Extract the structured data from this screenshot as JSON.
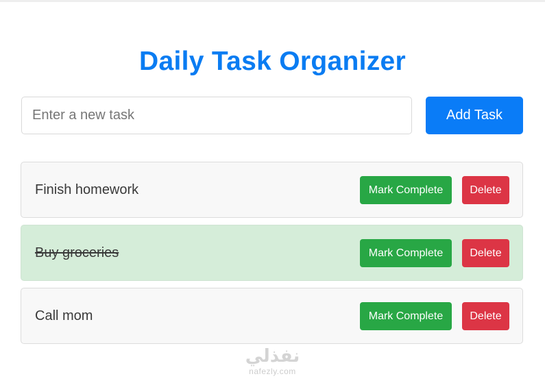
{
  "app": {
    "title": "Daily Task Organizer"
  },
  "input": {
    "placeholder": "Enter a new task",
    "value": ""
  },
  "add_button_label": "Add Task",
  "tasks": [
    {
      "text": "Finish homework",
      "completed": false,
      "complete_label": "Mark Complete",
      "delete_label": "Delete"
    },
    {
      "text": "Buy groceries",
      "completed": true,
      "complete_label": "Mark Complete",
      "delete_label": "Delete"
    },
    {
      "text": "Call mom",
      "completed": false,
      "complete_label": "Mark Complete",
      "delete_label": "Delete"
    }
  ],
  "watermark": {
    "logo_text": "نفذلي",
    "site_text": "nafezly.com"
  },
  "colors": {
    "title": "#0a7cf2",
    "primary": "#0a7cf7",
    "success": "#28a745",
    "danger": "#dc3545",
    "completed_bg": "#d5edd9"
  }
}
